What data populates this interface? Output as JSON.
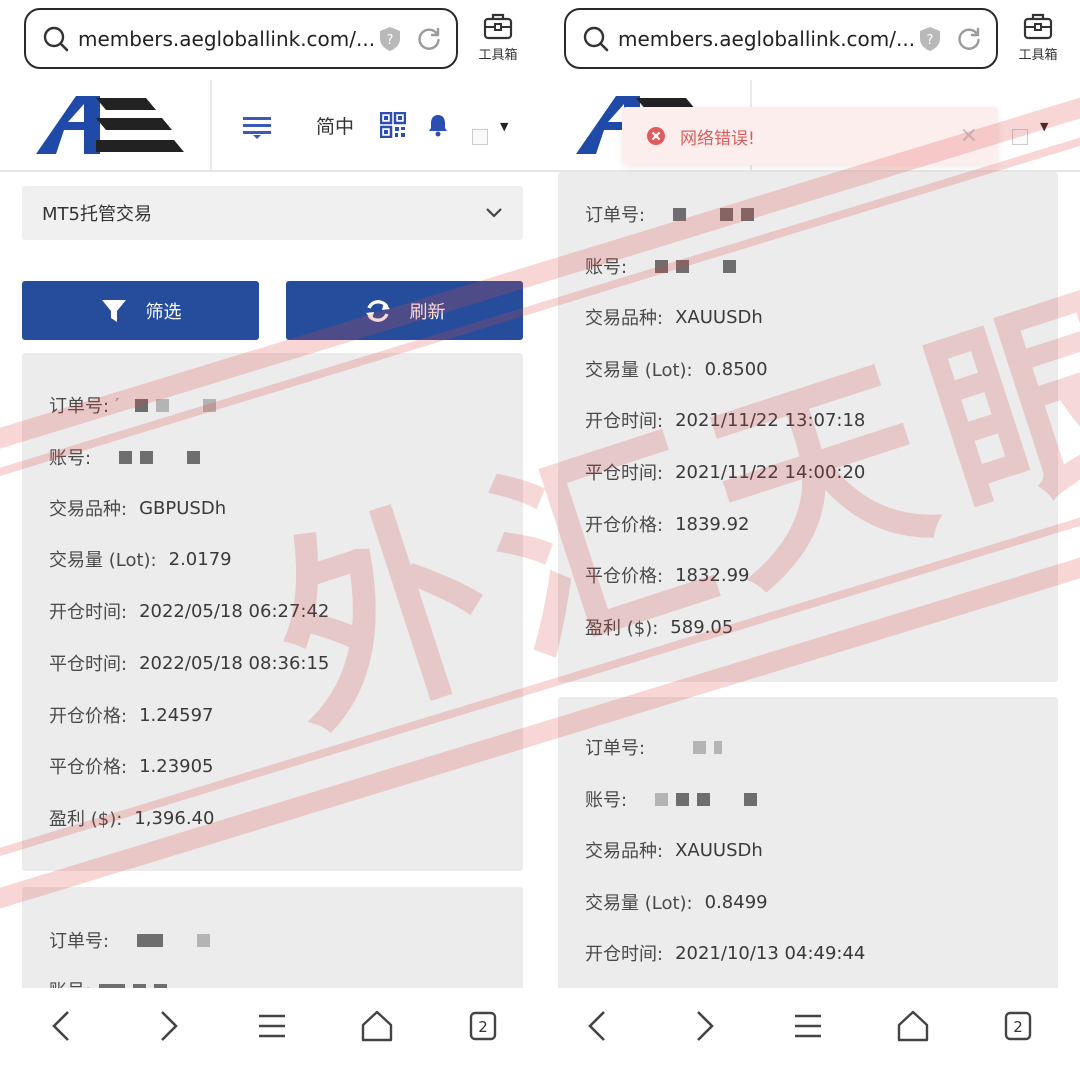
{
  "browser": {
    "url": "members.aegloballink.com/...",
    "toolbox_label": "工具箱",
    "tab_count": "2"
  },
  "header": {
    "language": "简中"
  },
  "left": {
    "category_select": "MT5托管交易",
    "filter_button": "筛选",
    "refresh_button": "刷新",
    "card1": {
      "order_no_label": "订单号:",
      "order_no_fragment": "′",
      "account_label": "账号:",
      "symbol_label": "交易品种:",
      "symbol": "GBPUSDh",
      "volume_label": "交易量 (Lot):",
      "volume": "2.0179",
      "open_time_label": "开仓时间:",
      "open_time": "2022/05/18 06:27:42",
      "close_time_label": "平仓时间:",
      "close_time": "2022/05/18 08:36:15",
      "open_price_label": "开仓价格:",
      "open_price": "1.24597",
      "close_price_label": "平仓价格:",
      "close_price": "1.23905",
      "profit_label": "盈利 ($):",
      "profit": "1,396.40"
    },
    "card2": {
      "order_no_label": "订单号:",
      "account_label": "账号:"
    }
  },
  "right": {
    "toast_message": "网络错误!",
    "card1": {
      "order_no_label": "订单号:",
      "account_label": "账号:",
      "symbol_label": "交易品种:",
      "symbol": "XAUUSDh",
      "volume_label": "交易量 (Lot):",
      "volume": "0.8500",
      "open_time_label": "开仓时间:",
      "open_time": "2021/11/22 13:07:18",
      "close_time_label": "平仓时间:",
      "close_time": "2021/11/22 14:00:20",
      "open_price_label": "开仓价格:",
      "open_price": "1839.92",
      "close_price_label": "平仓价格:",
      "close_price": "1832.99",
      "profit_label": "盈利 ($):",
      "profit": "589.05"
    },
    "card2": {
      "order_no_label": "订单号:",
      "account_label": "账号:",
      "symbol_label": "交易品种:",
      "symbol": "XAUUSDh",
      "volume_label": "交易量 (Lot):",
      "volume": "0.8499",
      "open_time_label": "开仓时间:",
      "open_time": "2021/10/13 04:49:44"
    }
  },
  "watermark": "外汇天眼",
  "colors": {
    "primary_button": "#254d9b",
    "logo_blue": "#1f4aa8",
    "logo_dark": "#222222",
    "error_red": "#e25b5b",
    "card_bg": "#ececec"
  },
  "icons": [
    "search-icon",
    "shield-icon",
    "reload-icon",
    "toolbox-icon",
    "menu-icon",
    "qr-code-icon",
    "bell-icon",
    "chevron-down-icon",
    "filter-icon",
    "refresh-icon",
    "error-icon",
    "close-icon",
    "back-icon",
    "forward-icon",
    "menu-lines-icon",
    "home-icon",
    "tabs-icon"
  ]
}
